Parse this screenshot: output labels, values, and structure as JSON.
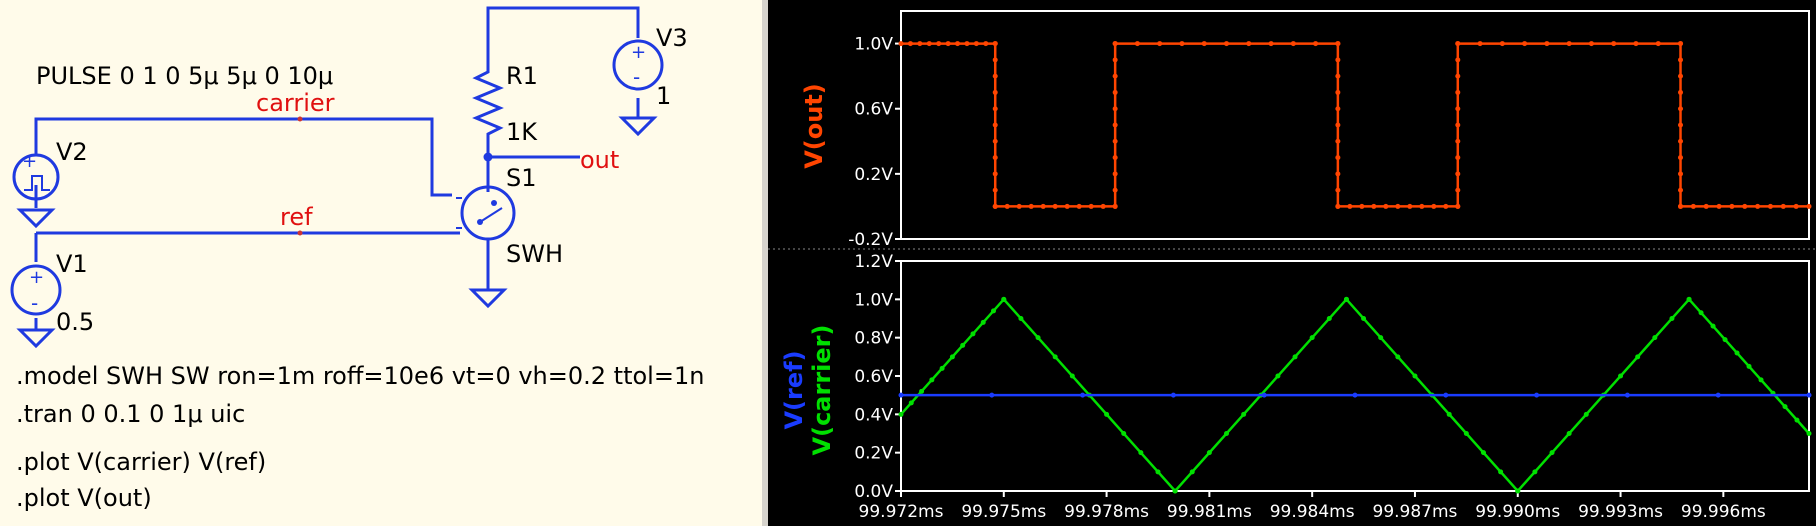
{
  "schematic": {
    "pulse_label": "PULSE 0 1 0 5μ 5μ 0 10μ",
    "net_carrier": "carrier",
    "net_ref": "ref",
    "net_out": "out",
    "v1": {
      "name": "V1",
      "value": "0.5"
    },
    "v2": {
      "name": "V2"
    },
    "v3": {
      "name": "V3",
      "value": "1"
    },
    "r1": {
      "name": "R1",
      "value": "1K"
    },
    "s1": {
      "name": "S1",
      "model": "SWH"
    },
    "directives": [
      ".model SWH SW ron=1m roff=10e6 vt=0 vh=0.2 ttol=1n",
      ".tran 0 0.1 0 1μ uic",
      ".plot V(carrier) V(ref)",
      ".plot V(out)"
    ]
  },
  "colors": {
    "wire": "#1f3ae0",
    "net_label": "#e01010",
    "schematic_bg": "#fffbea",
    "out_trace": "#ff4500",
    "carrier_trace": "#00e000",
    "ref_trace": "#1a3cff"
  },
  "chart_data": [
    {
      "type": "line",
      "ylabel": "V(out)",
      "x_unit": "ms",
      "xlim": [
        99.972,
        99.9985
      ],
      "ylim": [
        -0.2,
        1.2
      ],
      "yticks": [
        "1.0V",
        "0.6V",
        "0.2V",
        "-0.2V"
      ],
      "ytick_values": [
        1.0,
        0.6,
        0.2,
        -0.2
      ],
      "grid": false,
      "series": [
        {
          "name": "V(out)",
          "color": "#ff4500",
          "x": [
            99.972,
            99.97475,
            99.97475,
            99.97825,
            99.97825,
            99.98475,
            99.98475,
            99.98825,
            99.98825,
            99.99475,
            99.99475,
            99.9985
          ],
          "y": [
            1.0,
            1.0,
            0.0,
            0.0,
            1.0,
            1.0,
            0.0,
            0.0,
            1.0,
            1.0,
            0.0,
            0.0
          ]
        }
      ]
    },
    {
      "type": "line",
      "ylabel": "V(ref) V(carrier)",
      "x_unit": "ms",
      "xlim": [
        99.972,
        99.9985
      ],
      "ylim": [
        0.0,
        1.2
      ],
      "yticks": [
        "1.2V",
        "1.0V",
        "0.8V",
        "0.6V",
        "0.4V",
        "0.2V",
        "0.0V"
      ],
      "ytick_values": [
        1.2,
        1.0,
        0.8,
        0.6,
        0.4,
        0.2,
        0.0
      ],
      "xticks": [
        "99.972ms",
        "99.975ms",
        "99.978ms",
        "99.981ms",
        "99.984ms",
        "99.987ms",
        "99.990ms",
        "99.993ms",
        "99.996ms"
      ],
      "xtick_values": [
        99.972,
        99.975,
        99.978,
        99.981,
        99.984,
        99.987,
        99.99,
        99.993,
        99.996
      ],
      "grid": false,
      "series": [
        {
          "name": "V(carrier)",
          "color": "#00e000",
          "x": [
            99.972,
            99.975,
            99.98,
            99.985,
            99.99,
            99.995,
            99.9985
          ],
          "y": [
            0.4,
            1.0,
            0.0,
            1.0,
            0.0,
            1.0,
            0.3
          ]
        },
        {
          "name": "V(ref)",
          "color": "#1a3cff",
          "x": [
            99.972,
            99.9985
          ],
          "y": [
            0.5,
            0.5
          ]
        }
      ]
    }
  ]
}
